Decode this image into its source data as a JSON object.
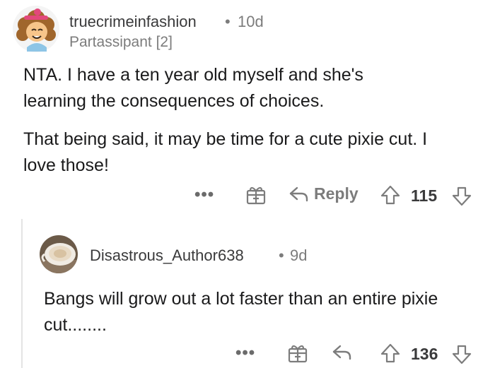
{
  "comment1": {
    "username": "truecrimeinfashion",
    "age": "10d",
    "flair": "Partassipant [2]",
    "paragraph1": "NTA. I have a ten year old myself and she's learning the consequences of choices.",
    "paragraph2": "That being said, it may be time for a cute pixie cut. I love those!",
    "actions": {
      "more": "•••",
      "reply_label": "Reply",
      "score": "115"
    }
  },
  "comment2": {
    "username": "Disastrous_Author638",
    "age": "9d",
    "body": "Bangs will grow out a lot faster than an entire pixie cut........",
    "actions": {
      "more": "•••",
      "score": "136"
    }
  },
  "separator": "•",
  "icons": {
    "more": "ellipsis-icon",
    "award": "award-gift-icon",
    "reply": "reply-arrow-icon",
    "upvote": "upvote-arrow-icon",
    "downvote": "downvote-arrow-icon"
  },
  "colors": {
    "text": "#1a1a1b",
    "meta": "#7c7c7c",
    "avatar_bg": "#f2f2f2"
  }
}
